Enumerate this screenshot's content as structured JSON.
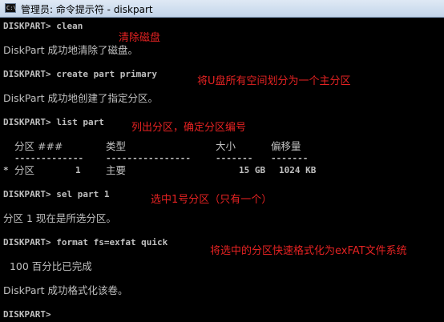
{
  "window": {
    "title": "管理员: 命令提示符 - diskpart",
    "icon_text": "C:\\"
  },
  "console": {
    "clean_cmd": "DISKPART> clean",
    "clean_result": "DiskPart 成功地清除了磁盘。",
    "create_cmd": "DISKPART> create part primary",
    "create_result": "DiskPart 成功地创建了指定分区。",
    "list_cmd": "DISKPART> list part",
    "table": {
      "headers": [
        "分区 ###",
        "类型",
        "大小",
        "偏移量"
      ],
      "rules": [
        "-------------",
        "----------------",
        "-------",
        "-------"
      ],
      "row": {
        "marker": "*",
        "partition": "分区",
        "number": "1",
        "type": "主要",
        "size": "15 GB",
        "offset": "1024 KB"
      }
    },
    "sel_cmd": "DISKPART> sel part 1",
    "sel_result": "分区 1 现在是所选分区。",
    "format_cmd": "DISKPART> format fs=exfat quick",
    "progress_text": "  100 百分比已完成",
    "format_result": "DiskPart 成功格式化该卷。",
    "prompt": "DISKPART>"
  },
  "annotations": {
    "clean": "清除磁盘",
    "create": "将U盘所有空间划分为一个主分区",
    "list": "列出分区，确定分区编号",
    "select": "选中1号分区（只有一个）",
    "format": "将选中的分区快速格式化为exFAT文件系统"
  },
  "colors": {
    "console_bg": "#000000",
    "console_text": "#c0c0c0",
    "annotation": "#e52222"
  }
}
